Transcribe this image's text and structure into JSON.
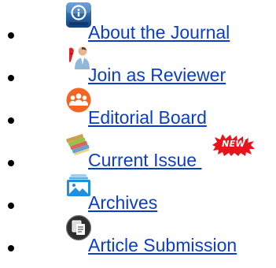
{
  "menu": {
    "items": [
      {
        "label": "About the Journal",
        "icon": "info-icon"
      },
      {
        "label": "Join as Reviewer",
        "icon": "reviewer-icon"
      },
      {
        "label": "Editorial Board",
        "icon": "board-members-icon"
      },
      {
        "label": "Current Issue ",
        "icon": "books-icon",
        "badge": "NEW"
      },
      {
        "label": "Archives",
        "icon": "archive-image-icon"
      },
      {
        "label": "Article Submission",
        "icon": "document-copy-icon"
      }
    ]
  },
  "colors": {
    "link": "#0c3dc8",
    "badge": "#e8141c",
    "board_icon": "#f26522",
    "info_icon": "#1f5fa8"
  }
}
